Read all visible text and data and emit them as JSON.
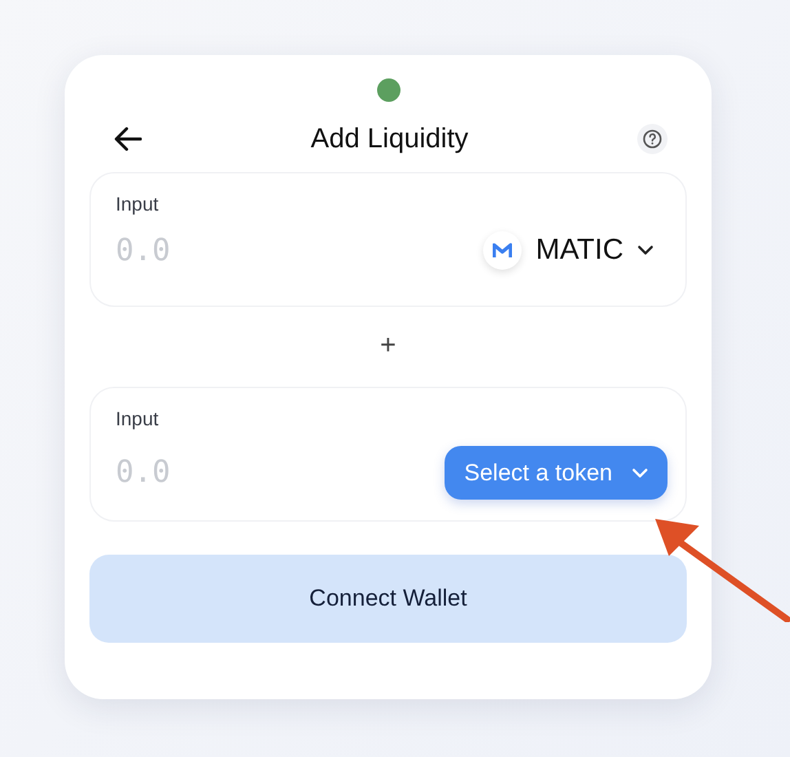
{
  "status_dot": {
    "color": "#5c9f5f"
  },
  "header": {
    "title": "Add Liquidity"
  },
  "inputs": [
    {
      "label": "Input",
      "placeholder": "0.0",
      "token": {
        "kind": "token",
        "text": "MATIC"
      }
    },
    {
      "label": "Input",
      "placeholder": "0.0",
      "token": {
        "kind": "select",
        "text": "Select a token"
      }
    }
  ],
  "separator": "+",
  "connect_button": "Connect Wallet"
}
